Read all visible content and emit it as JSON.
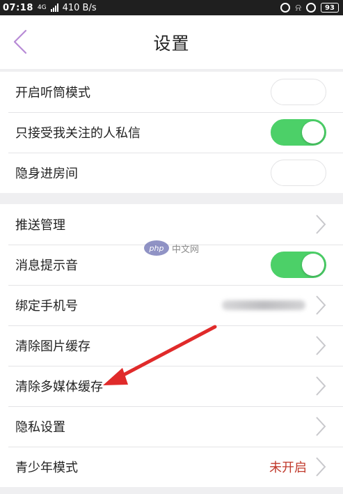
{
  "status_bar": {
    "time": "07:18",
    "network": "4G",
    "speed": "410 B/s",
    "battery": "93"
  },
  "header": {
    "title": "设置"
  },
  "group1": [
    {
      "label": "开启听筒模式",
      "control": "toggle",
      "on": false
    },
    {
      "label": "只接受我关注的人私信",
      "control": "toggle",
      "on": true
    },
    {
      "label": "隐身进房间",
      "control": "toggle",
      "on": false
    }
  ],
  "group2": [
    {
      "label": "推送管理",
      "control": "chevron"
    },
    {
      "label": "消息提示音",
      "control": "toggle",
      "on": true
    },
    {
      "label": "绑定手机号",
      "control": "chevron",
      "blurred_value": true
    },
    {
      "label": "清除图片缓存",
      "control": "chevron"
    },
    {
      "label": "清除多媒体缓存",
      "control": "chevron"
    },
    {
      "label": "隐私设置",
      "control": "chevron"
    },
    {
      "label": "青少年模式",
      "control": "chevron",
      "value": "未开启"
    }
  ],
  "watermark": {
    "logo": "php",
    "text": "中文网"
  },
  "colors": {
    "accent_back": "#b78ad6",
    "toggle_on": "#4cd068",
    "value_red": "#c0392b",
    "annotation_arrow": "#e02a2a"
  }
}
